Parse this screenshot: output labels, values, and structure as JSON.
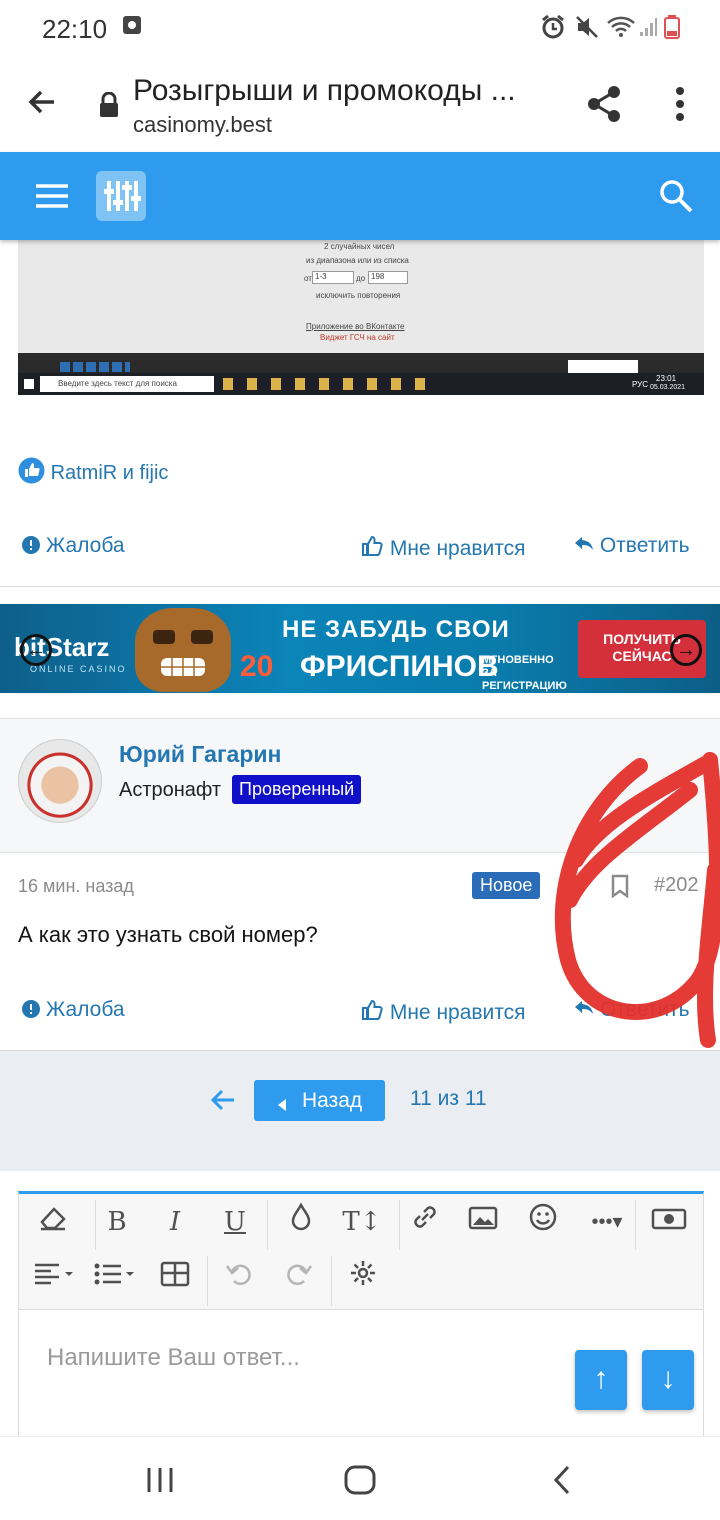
{
  "status_bar": {
    "time": "22:10",
    "icons": [
      "alarm-icon",
      "mute-icon",
      "wifi-icon",
      "signal-icon",
      "battery-icon"
    ]
  },
  "url_bar": {
    "page_title": "Розыгрыши и промокоды ...",
    "domain": "casinomy.best"
  },
  "site_header": {
    "icons": [
      "menu-icon",
      "filter-icon",
      "search-icon"
    ]
  },
  "embedded_screenshot": {
    "line1": "2 случайных чисел",
    "line2": "из диапазона или  из списка",
    "range_from_label": "от",
    "range_from": "1-3",
    "range_to_label": "до",
    "range_to": "198",
    "exclude_repeats": "исключить повторения",
    "app_link": "Приложение во ВКонтакте",
    "widget_link": "Виджет ГСЧ на сайт",
    "taskbar_search": "Введите здесь текст для поиска",
    "taskbar_time": "23:01",
    "taskbar_date": "05.03.2021",
    "taskbar_lang": "РУС"
  },
  "post1": {
    "reactions": "RatmiR и fijic",
    "report": "Жалоба",
    "like": "Мне нравится",
    "reply": "Ответить"
  },
  "banner": {
    "brand": "bitStarz",
    "brand_sub": "ONLINE CASINO",
    "headline": "НЕ ЗАБУДЬ СВОИ",
    "count": "20",
    "freespins": "ФРИСПИНОВ",
    "instant": "МГНОВЕННО ЗА РЕГИСТРАЦИЮ",
    "cta": "ПОЛУЧИТЬ СЕЙЧАС"
  },
  "post2": {
    "username": "Юрий Гагарин",
    "user_title": "Астронафт",
    "user_badge": "Проверенный",
    "time": "16 мин. назад",
    "new_badge": "Новое",
    "post_number": "#202",
    "text": "А как это узнать свой номер?",
    "report": "Жалоба",
    "like": "Мне нравится",
    "reply": "Ответить"
  },
  "pagination": {
    "back_label": "Назад",
    "page_info": "11 из 11"
  },
  "editor": {
    "placeholder": "Напишите Ваш ответ...",
    "tools": [
      "eraser",
      "bold",
      "italic",
      "underline",
      "color",
      "text-size",
      "link",
      "image",
      "emoji",
      "more",
      "money",
      "align",
      "list",
      "table",
      "undo",
      "redo",
      "settings"
    ]
  },
  "colors": {
    "header_blue": "#2f9bee",
    "link_blue": "#2577b1",
    "badge_blue": "#1010c8",
    "new_badge": "#2b6cb8",
    "scribble_red": "#e3302b"
  }
}
